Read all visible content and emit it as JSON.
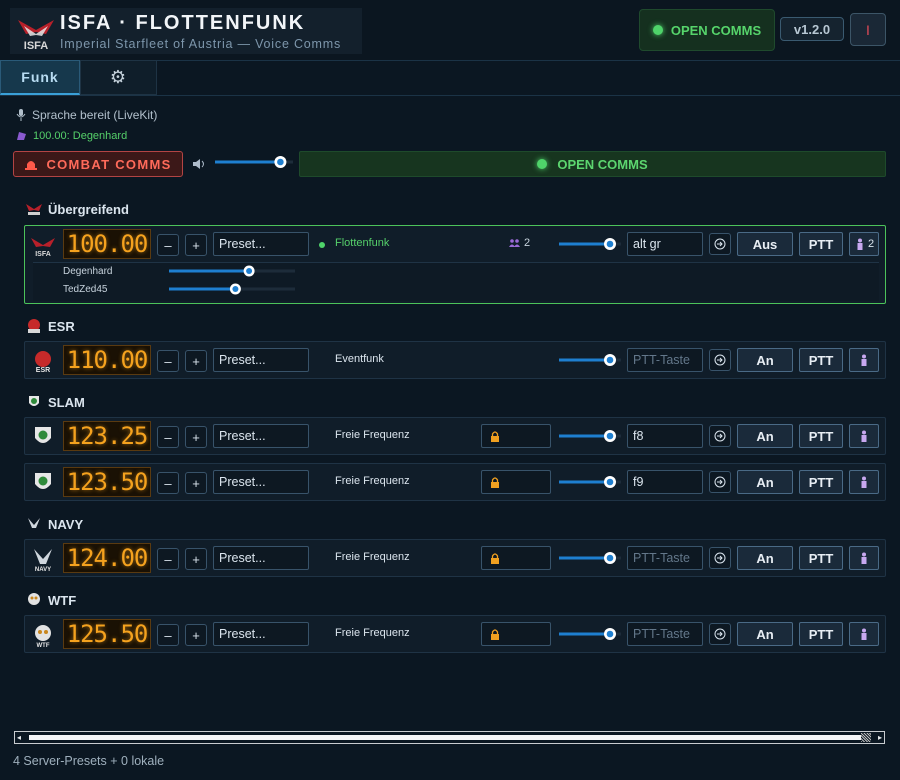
{
  "header": {
    "title": "ISFA · FLOTTENFUNK",
    "subtitle": "Imperial Starfleet of Austria — Voice Comms",
    "comms_label": "OPEN COMMS",
    "version": "v1.2.0",
    "power_glyph": "I"
  },
  "tabs": [
    {
      "label": "Funk",
      "active": true
    },
    {
      "label": "⚙",
      "icon": "gear-icon"
    }
  ],
  "status": {
    "voice": "Sprache bereit (LiveKit)",
    "active_channel": "100.00: Degenhard"
  },
  "controls": {
    "combat_label": "COMBAT COMMS",
    "open_comms_label": "OPEN COMMS",
    "master_volume": 0.9
  },
  "groups": [
    {
      "name": "Übergreifend",
      "icon": "isfa-logo-icon",
      "rows": [
        {
          "freq": "100.00",
          "preset": "Preset...",
          "channel": "Flottenfunk",
          "active": true,
          "users": "2",
          "volume": 0.9,
          "key": "alt gr",
          "toggle": "Aus",
          "ptt": "PTT",
          "members": [
            {
              "name": "Degenhard",
              "volume": 0.65
            },
            {
              "name": "TedZed45",
              "volume": 0.53
            }
          ]
        }
      ]
    },
    {
      "name": "ESR",
      "icon": "esr-logo-icon",
      "rows": [
        {
          "freq": "110.00",
          "preset": "Preset...",
          "channel": "Eventfunk",
          "volume": 0.9,
          "key_placeholder": "PTT-Taste",
          "toggle": "An",
          "ptt": "PTT"
        }
      ]
    },
    {
      "name": "SLAM",
      "icon": "slam-logo-icon",
      "rows": [
        {
          "freq": "123.25",
          "preset": "Preset...",
          "channel": "Freie Frequenz",
          "locked": true,
          "volume": 0.9,
          "key": "f8",
          "toggle": "An",
          "ptt": "PTT"
        },
        {
          "freq": "123.50",
          "preset": "Preset...",
          "channel": "Freie Frequenz",
          "locked": true,
          "volume": 0.9,
          "key": "f9",
          "toggle": "An",
          "ptt": "PTT"
        }
      ]
    },
    {
      "name": "NAVY",
      "icon": "navy-logo-icon",
      "rows": [
        {
          "freq": "124.00",
          "preset": "Preset...",
          "channel": "Freie Frequenz",
          "locked": true,
          "volume": 0.9,
          "key_placeholder": "PTT-Taste",
          "toggle": "An",
          "ptt": "PTT"
        }
      ]
    },
    {
      "name": "WTF",
      "icon": "wtf-logo-icon",
      "rows": [
        {
          "freq": "125.50",
          "preset": "Preset...",
          "channel": "Freie Frequenz",
          "locked": true,
          "volume": 0.9,
          "key_placeholder": "PTT-Taste",
          "toggle": "An",
          "ptt": "PTT"
        }
      ]
    }
  ],
  "footer": {
    "text": "4 Server-Presets + 0 lokale"
  },
  "colors": {
    "accent": "#1e7fd0",
    "freq": "#f5a21e",
    "ok_green": "#55d06a",
    "alert_red": "#ff6a5a"
  }
}
